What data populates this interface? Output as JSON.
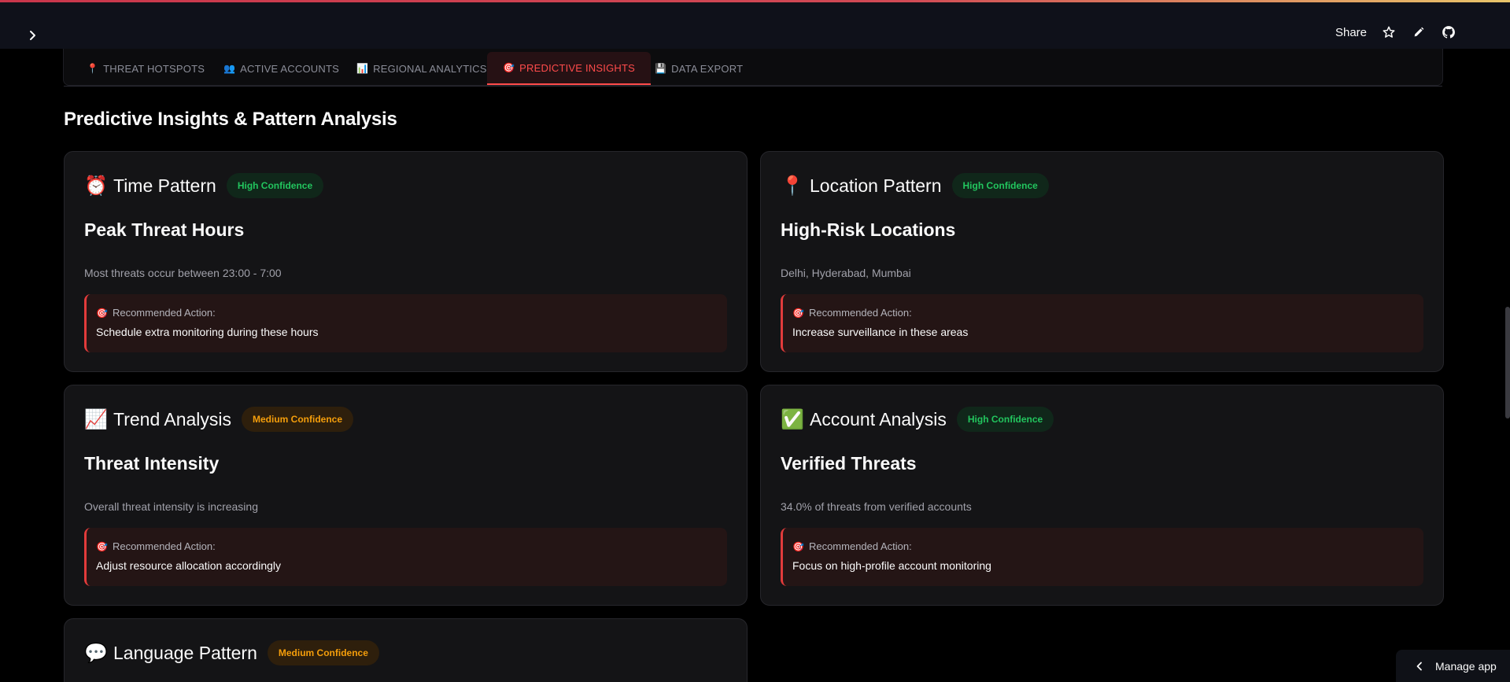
{
  "header": {
    "share_label": "Share",
    "icons": [
      "chevron-right-icon",
      "star-icon",
      "pencil-icon",
      "github-icon"
    ]
  },
  "tabs": [
    {
      "emoji": "📍",
      "label": "THREAT HOTSPOTS",
      "active": false
    },
    {
      "emoji": "👥",
      "label": "ACTIVE ACCOUNTS",
      "active": false
    },
    {
      "emoji": "📊",
      "label": "REGIONAL ANALYTICS",
      "active": false
    },
    {
      "emoji": "🎯",
      "label": "PREDICTIVE INSIGHTS",
      "active": true
    },
    {
      "emoji": "💾",
      "label": "DATA EXPORT",
      "active": false
    }
  ],
  "page_title": "Predictive Insights & Pattern Analysis",
  "action_label": "Recommended Action:",
  "action_emoji": "🎯",
  "cards": [
    {
      "emoji": "⏰",
      "title": "Time Pattern",
      "confidence": "High Confidence",
      "heading": "Peak Threat Hours",
      "description": "Most threats occur between 23:00 - 7:00",
      "action": "Schedule extra monitoring during these hours"
    },
    {
      "emoji": "📍",
      "title": "Location Pattern",
      "confidence": "High Confidence",
      "heading": "High-Risk Locations",
      "description": "Delhi, Hyderabad, Mumbai",
      "action": "Increase surveillance in these areas"
    },
    {
      "emoji": "📈",
      "title": "Trend Analysis",
      "confidence": "Medium Confidence",
      "heading": "Threat Intensity",
      "description": "Overall threat intensity is increasing",
      "action": "Adjust resource allocation accordingly"
    },
    {
      "emoji": "✅",
      "title": "Account Analysis",
      "confidence": "High Confidence",
      "heading": "Verified Threats",
      "description": "34.0% of threats from verified accounts",
      "action": "Focus on high-profile account monitoring"
    },
    {
      "emoji": "💬",
      "title": "Language Pattern",
      "confidence": "Medium Confidence"
    }
  ],
  "manage_app_label": "Manage app",
  "colors": {
    "accent_red": "#ff4b4b",
    "high_confidence": "#22c55e",
    "medium_confidence": "#f59e0b",
    "background": "#000000",
    "card_background": "#141416"
  }
}
